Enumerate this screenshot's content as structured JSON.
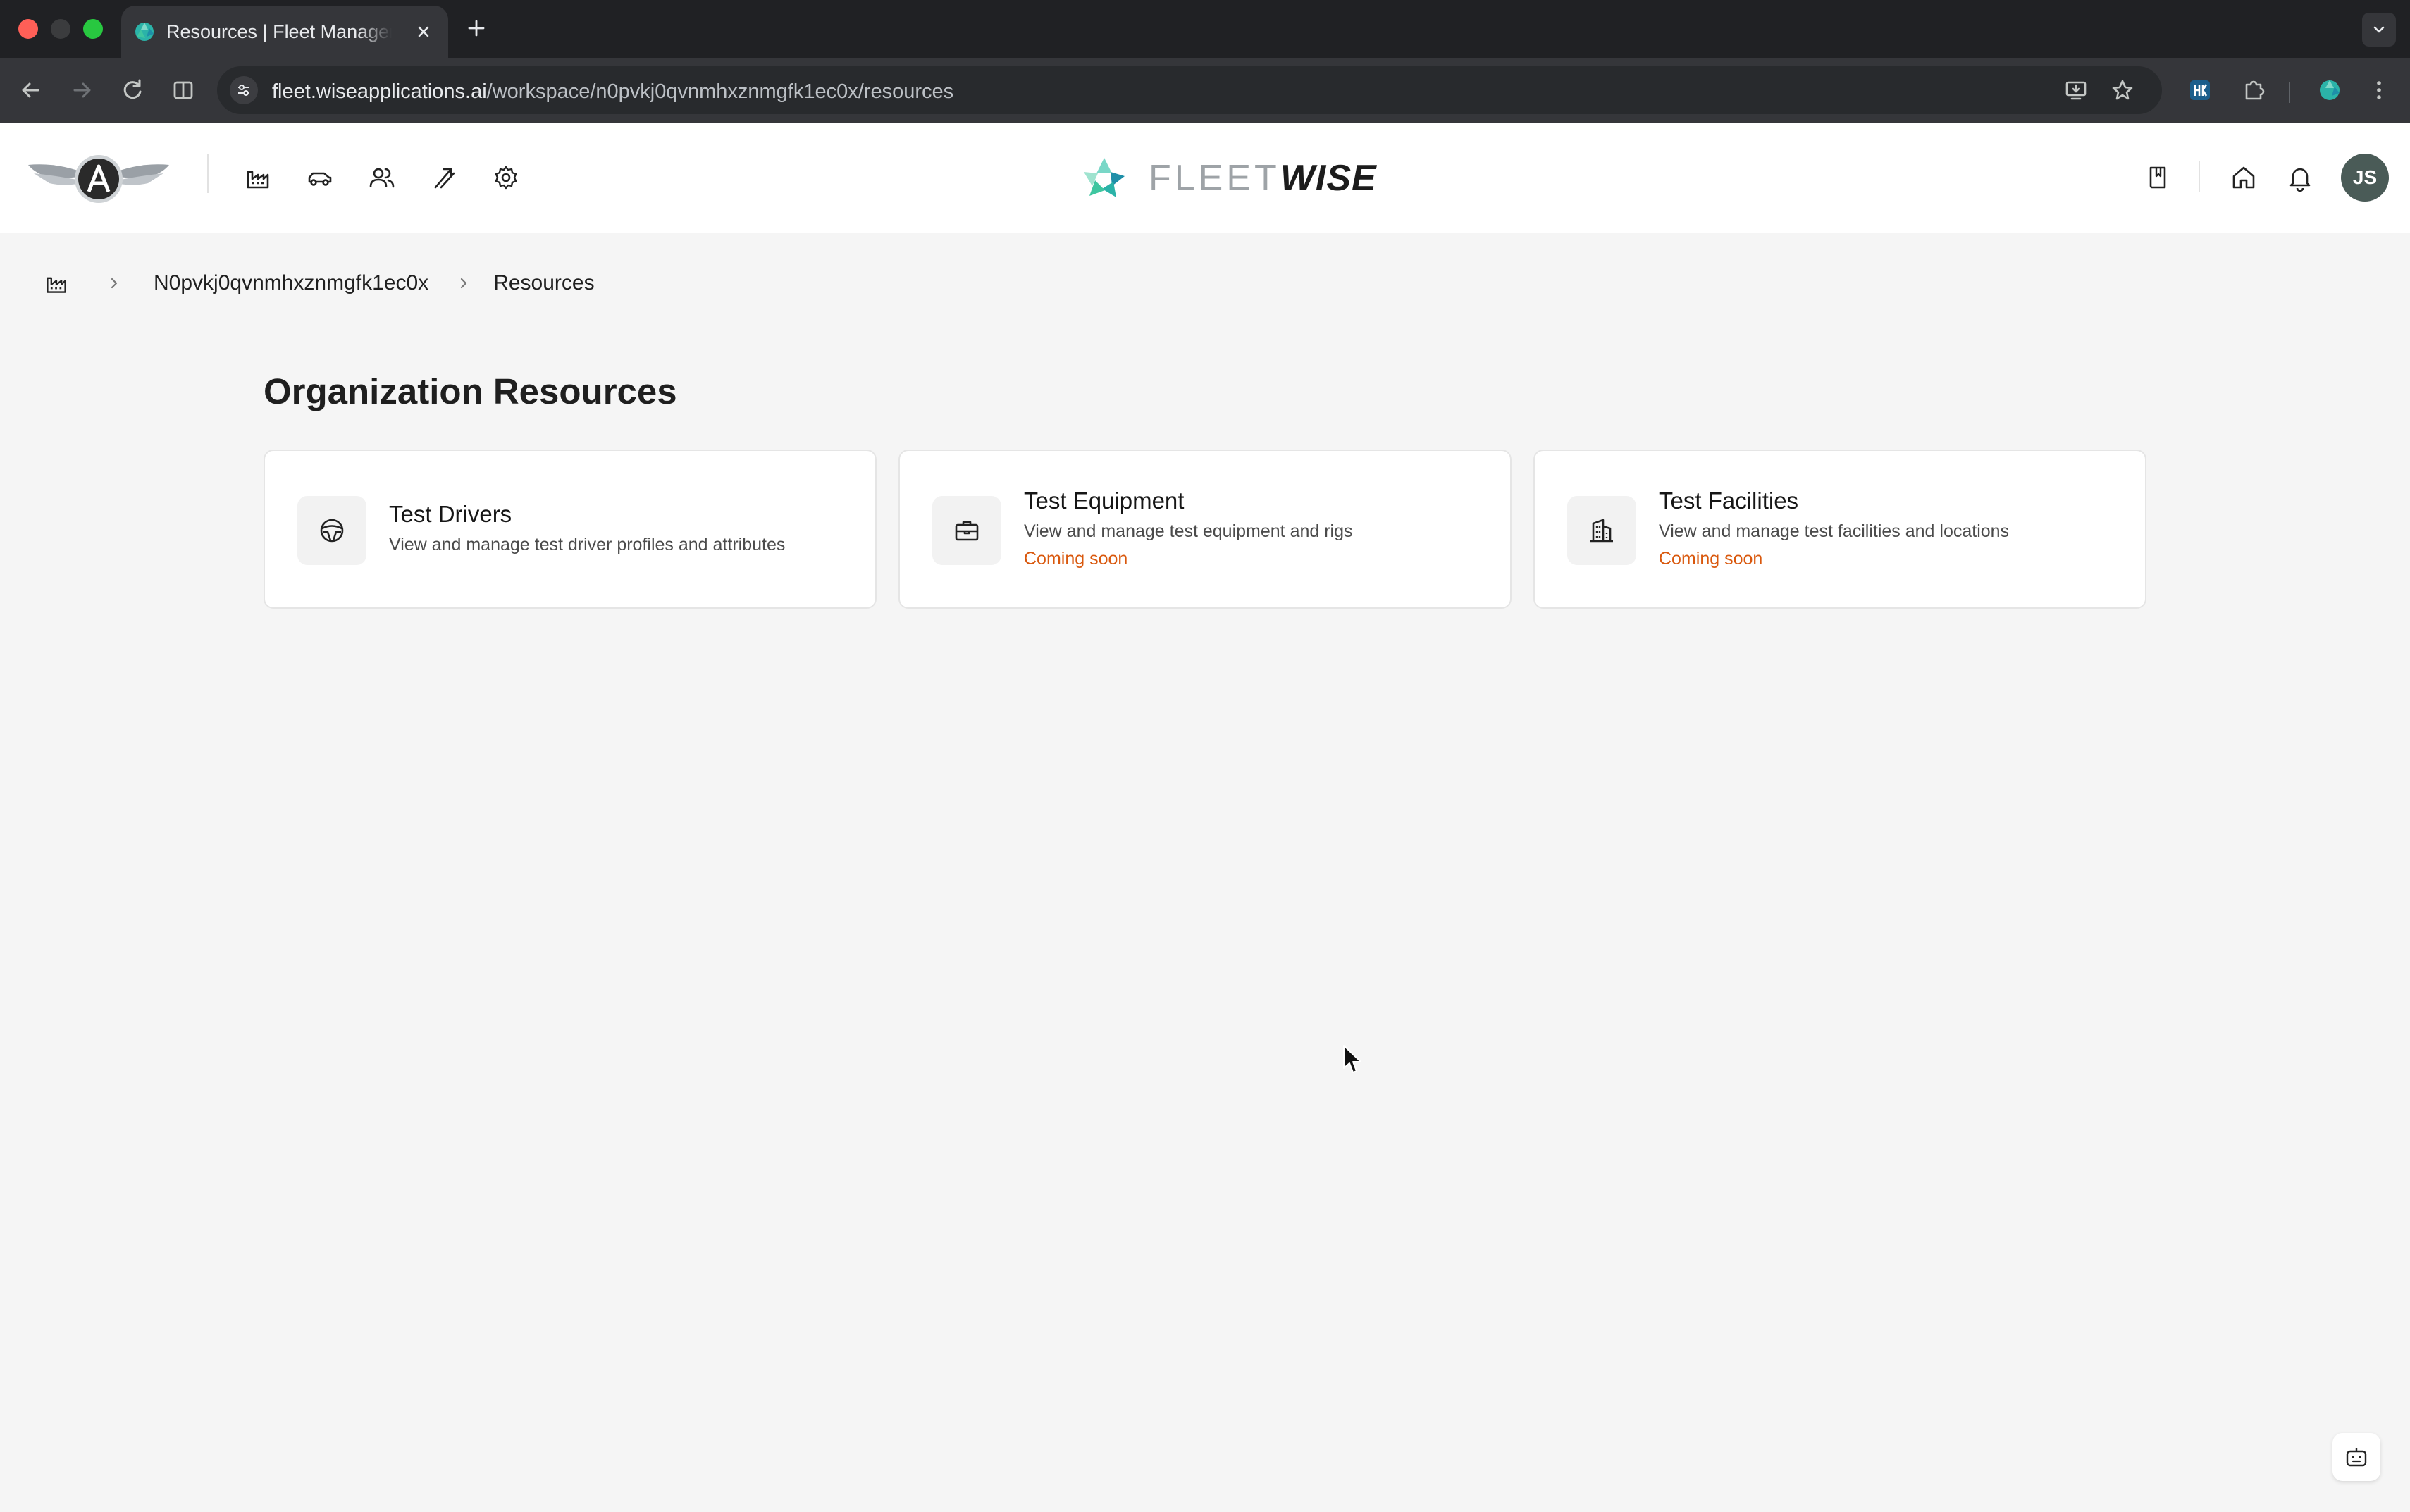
{
  "browser": {
    "tab_title": "Resources | Fleet Management",
    "url_host": "fleet.wiseapplications.ai",
    "url_path": "/workspace/n0pvkj0qvnmhxznmgfk1ec0x/resources"
  },
  "header": {
    "brand_name_light": "FLEET",
    "brand_name_bold": "WISE",
    "avatar_initials": "JS",
    "nav_icons": [
      "factory-icon",
      "car-icon",
      "users-icon",
      "route-icon",
      "gear-icon"
    ],
    "right_icons": [
      "book-icon",
      "home-icon",
      "bell-icon"
    ]
  },
  "breadcrumb": {
    "workspace": "N0pvkj0qvnmhxznmgfk1ec0x",
    "current": "Resources"
  },
  "page": {
    "title": "Organization Resources"
  },
  "cards": [
    {
      "title": "Test Drivers",
      "description": "View and manage test driver profiles and attributes",
      "status": "",
      "icon": "steering-wheel-icon"
    },
    {
      "title": "Test Equipment",
      "description": "View and manage test equipment and rigs",
      "status": "Coming soon",
      "icon": "briefcase-icon"
    },
    {
      "title": "Test Facilities",
      "description": "View and manage test facilities and locations",
      "status": "Coming soon",
      "icon": "building-icon"
    }
  ],
  "colors": {
    "accent_status": "#d9580d",
    "avatar_bg": "#4a5b57",
    "brand_teal": "#2bb3a8"
  }
}
